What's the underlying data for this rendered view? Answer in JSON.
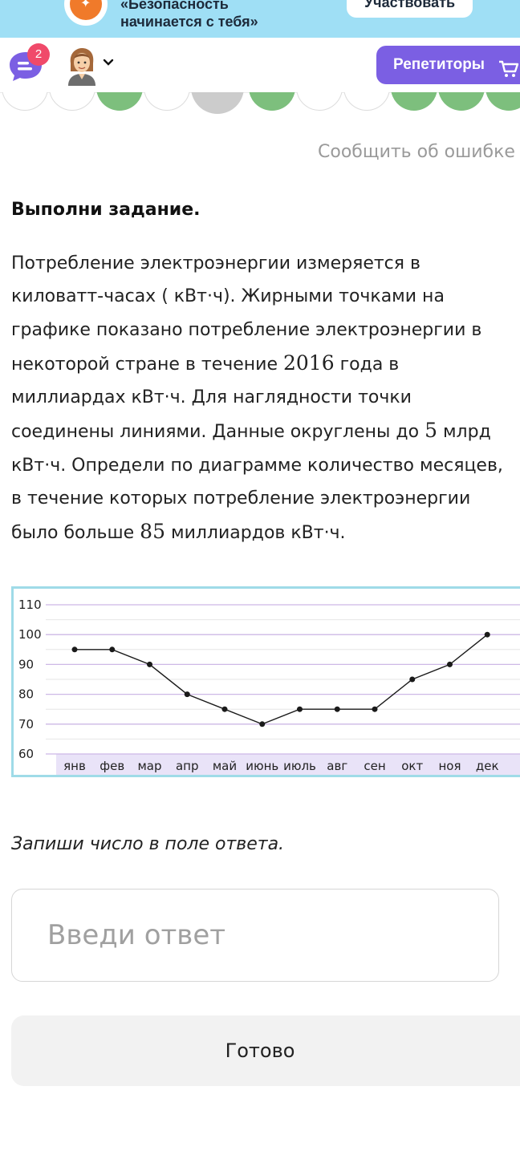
{
  "banner": {
    "line1": "«Безопасность",
    "line2": "начинается с тебя»",
    "button_label": "Участвовать",
    "background": "#9fdff5"
  },
  "header": {
    "notification_count": "2",
    "tutors_button_label": "Репетиторы",
    "accent": "#7b5fe3",
    "icons": [
      "chat-icon",
      "avatar",
      "chevron-down-icon",
      "cart-icon"
    ]
  },
  "progress": {
    "states": [
      "empty",
      "empty",
      "done",
      "empty",
      "current",
      "done",
      "empty",
      "empty",
      "done",
      "done",
      "done"
    ],
    "done_color": "#7dbf7d"
  },
  "report_error_label": "Сообщить об ошибке",
  "task": {
    "title": "Выполни задание.",
    "lines": [
      [
        "Потребление электроэнергии измеряется в"
      ],
      [
        "киловатт-часах ( кВт·ч). Жирными точками на"
      ],
      [
        "графике показано потребление электроэнергии в"
      ],
      [
        "некоторой стране в течение ",
        "2016",
        " года в"
      ],
      [
        "миллиардах кВт·ч. Для наглядности точки"
      ],
      [
        "соединены линиями. Данные округлены до ",
        "5",
        " млрд"
      ],
      [
        "кВт·ч. Определи по диаграмме количество месяцев,"
      ],
      [
        "в течение которых потребление электроэнергии"
      ],
      [
        "было больше ",
        "85",
        " миллиардов кВт·ч."
      ]
    ]
  },
  "chart_data": {
    "type": "line",
    "categories": [
      "янв",
      "фев",
      "мар",
      "апр",
      "май",
      "июнь",
      "июль",
      "авг",
      "сен",
      "окт",
      "ноя",
      "дек"
    ],
    "values": [
      95,
      95,
      90,
      80,
      75,
      70,
      75,
      75,
      75,
      85,
      90,
      100
    ],
    "y_ticks": [
      60,
      70,
      80,
      90,
      100,
      110
    ],
    "ylim": [
      60,
      110
    ],
    "minor_grid_step": 5,
    "grid": true,
    "major_grid_color": "#cdb8e6",
    "minor_grid_color": "#e6e6e6",
    "line_color": "#1a1a1a",
    "category_band_color": "#e9e3f8",
    "border_color": "#9fdbe8"
  },
  "instruction": "Запиши число в поле ответа.",
  "answer": {
    "placeholder": "Введи ответ",
    "value": ""
  },
  "submit_label": "Готово"
}
